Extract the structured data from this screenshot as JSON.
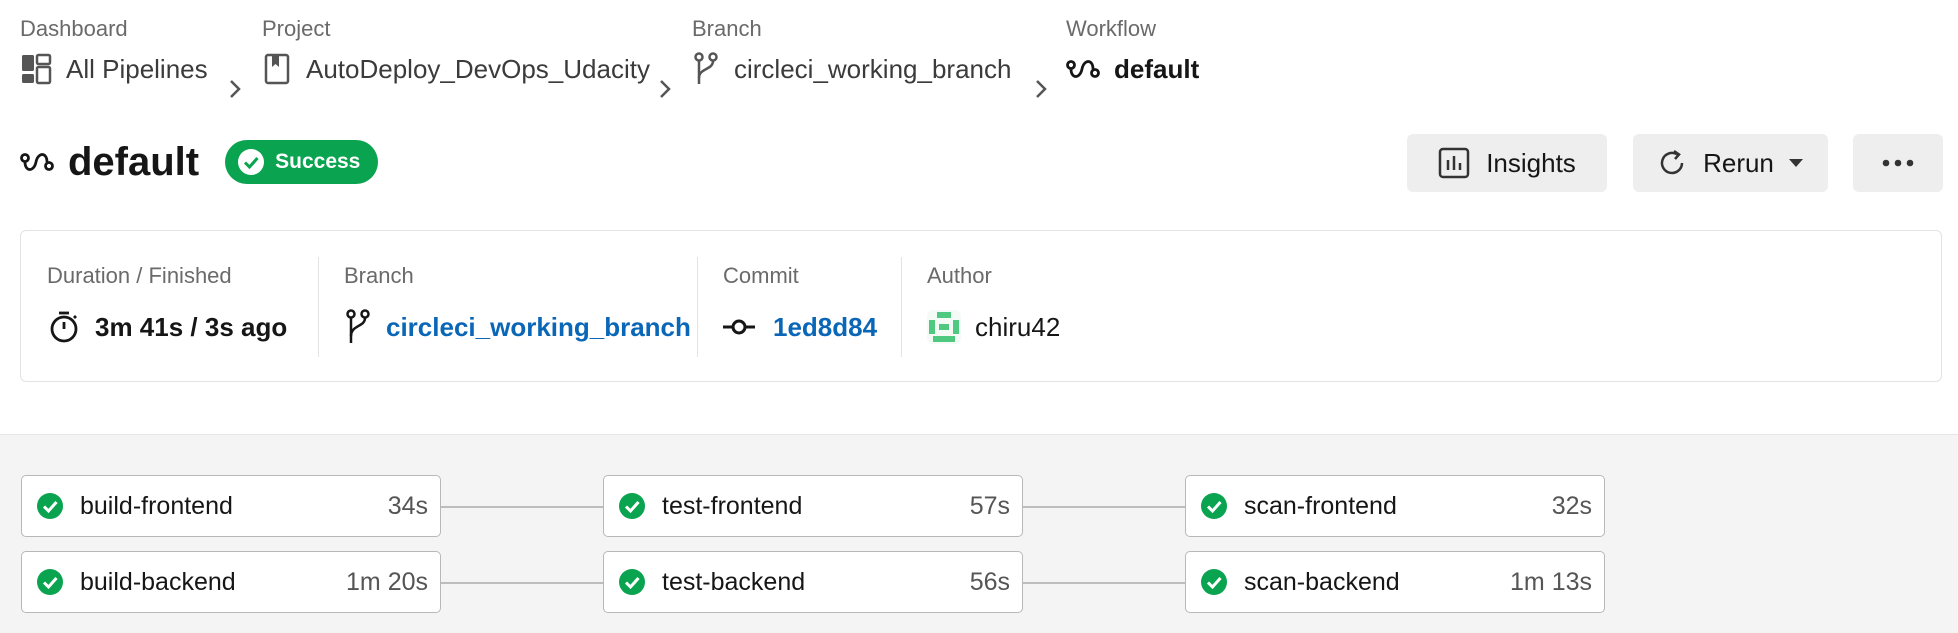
{
  "breadcrumb": {
    "dashboard": {
      "caption": "Dashboard",
      "label": "All Pipelines",
      "icon": "dashboard-icon"
    },
    "project": {
      "caption": "Project",
      "label": "AutoDeploy_DevOps_Udacity",
      "icon": "bookmark-icon"
    },
    "branch": {
      "caption": "Branch",
      "label": "circleci_working_branch",
      "icon": "branch-icon"
    },
    "workflow": {
      "caption": "Workflow",
      "label": "default",
      "icon": "workflow-icon"
    }
  },
  "header": {
    "title": "default",
    "status": "Success",
    "status_color": "#0aa34f"
  },
  "actions": {
    "insights_label": "Insights",
    "rerun_label": "Rerun"
  },
  "summary": {
    "duration": {
      "caption": "Duration / Finished",
      "value": "3m 41s / 3s ago"
    },
    "branch": {
      "caption": "Branch",
      "value": "circleci_working_branch"
    },
    "commit": {
      "caption": "Commit",
      "value": "1ed8d84"
    },
    "author": {
      "caption": "Author",
      "value": "chiru42"
    }
  },
  "jobs": {
    "build_frontend": {
      "name": "build-frontend",
      "duration": "34s"
    },
    "build_backend": {
      "name": "build-backend",
      "duration": "1m 20s"
    },
    "test_frontend": {
      "name": "test-frontend",
      "duration": "57s"
    },
    "test_backend": {
      "name": "test-backend",
      "duration": "56s"
    },
    "scan_frontend": {
      "name": "scan-frontend",
      "duration": "32s"
    },
    "scan_backend": {
      "name": "scan-backend",
      "duration": "1m 13s"
    }
  },
  "colors": {
    "link": "#0a66b7",
    "success": "#0aa34f"
  }
}
